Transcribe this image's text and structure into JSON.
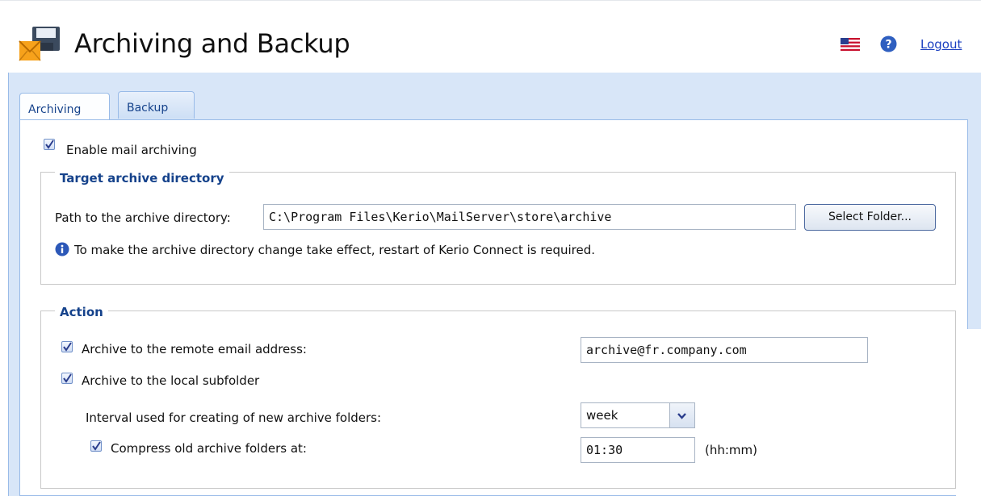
{
  "header": {
    "title": "Archiving and Backup",
    "logout_label": "Logout",
    "icons": [
      "archive-mail-icon",
      "us-flag-icon",
      "help-icon"
    ]
  },
  "tabs": [
    {
      "label": "Archiving",
      "active": true
    },
    {
      "label": "Backup",
      "active": false
    }
  ],
  "archiving": {
    "enable_label": "Enable mail archiving",
    "enable_checked": true,
    "target": {
      "legend": "Target archive directory",
      "path_label": "Path to the archive directory:",
      "path_value": "C:\\Program Files\\Kerio\\MailServer\\store\\archive",
      "select_button": "Select Folder...",
      "info_text": "To make the archive directory change take effect, restart of Kerio Connect is required."
    },
    "action": {
      "legend": "Action",
      "remote_label": "Archive to the remote email address:",
      "remote_checked": true,
      "remote_value": "archive@fr.company.com",
      "local_label": "Archive to the local subfolder",
      "local_checked": true,
      "interval_label": "Interval used for creating of new archive folders:",
      "interval_value": "week",
      "compress_label": "Compress old archive folders at:",
      "compress_checked": true,
      "compress_value": "01:30",
      "compress_unit": "(hh:mm)"
    }
  },
  "colors": {
    "accent": "#15428b",
    "shell_bg": "#d8e6f8",
    "border": "#99bbe8",
    "link": "#1a3fc0"
  }
}
